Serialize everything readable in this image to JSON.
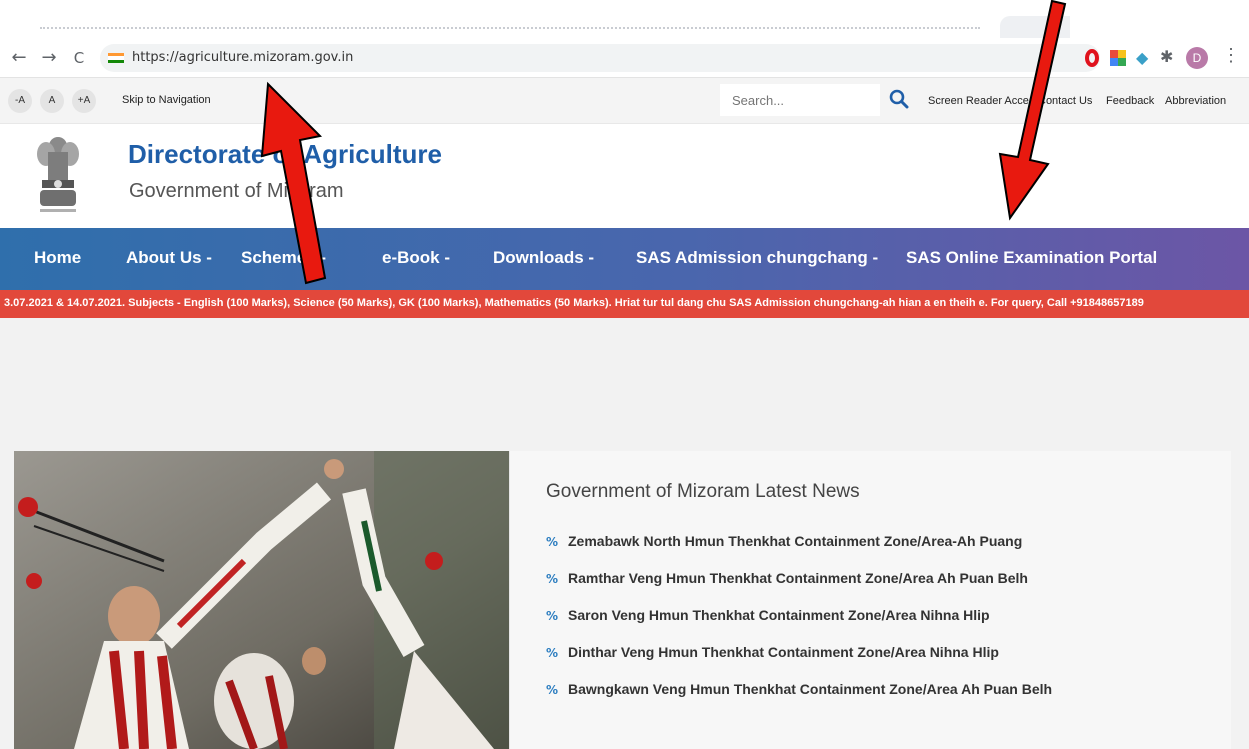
{
  "browser": {
    "url": "https://agriculture.mizoram.gov.in",
    "profile_initial": "D",
    "back_icon": "←",
    "forward_icon": "→",
    "reload_icon": "C",
    "menu_icon": "⋮"
  },
  "utility": {
    "font_decrease": "-A",
    "font_normal": "A",
    "font_increase": "+A",
    "skip_link": "Skip to Navigation",
    "search_placeholder": "Search...",
    "links": [
      "Screen Reader Access",
      "Contact Us",
      "Feedback",
      "Abbreviation"
    ]
  },
  "header": {
    "title": "Directorate of Agriculture",
    "subtitle": "Government of Mizoram"
  },
  "nav": [
    {
      "label": "Home"
    },
    {
      "label": "About Us -"
    },
    {
      "label": "Schemes -"
    },
    {
      "label": "e-Book -"
    },
    {
      "label": "Downloads -"
    },
    {
      "label": "SAS Admission chungchang -"
    },
    {
      "label": "SAS Online Examination Portal"
    }
  ],
  "ticker": {
    "text": "3.07.2021 & 14.07.2021. Subjects - English (100 Marks), Science (50 Marks), GK (100 Marks), Mathematics (50 Marks). Hriat tur tul dang chu SAS Admission chungchang-ah hian a en theih e. For query, Call +91848657189"
  },
  "news": {
    "title": "Government of Mizoram Latest News",
    "items": [
      "Zemabawk North Hmun Thenkhat Containment Zone/Area-Ah Puang",
      "Ramthar Veng Hmun Thenkhat Containment Zone/Area Ah Puan Belh",
      "Saron Veng Hmun Thenkhat Containment Zone/Area Nihna Hlip",
      "Dinthar Veng Hmun Thenkhat Containment Zone/Area Nihna Hlip",
      "Bawngkawn Veng Hmun Thenkhat Containment Zone/Area Ah Puan Belh"
    ]
  },
  "colors": {
    "nav_start": "#2f6fac",
    "nav_end": "#6c56a6",
    "ticker": "#e2483b",
    "title_blue": "#1f5ea8",
    "arrow_red": "#e8190f"
  }
}
